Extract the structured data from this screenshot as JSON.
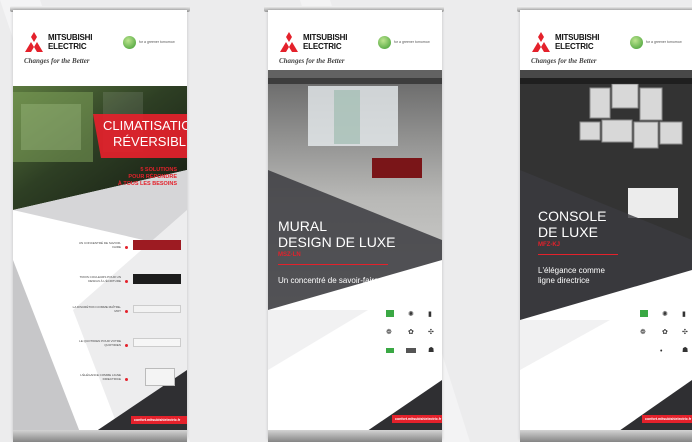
{
  "brand": {
    "name_line1": "MITSUBISHI",
    "name_line2": "ELECTRIC",
    "slogan": "Changes for the Better",
    "eco_text": "for a greener tomorrow"
  },
  "colors": {
    "brand_red": "#e4212b",
    "dark_grey": "#3b3b3f",
    "panel_bg": "#ffffff"
  },
  "banner1": {
    "title_line1": "CLIMATISATION",
    "title_line2": "RÉVERSIBLE",
    "subtitle_line1": "5 SOLUTIONS",
    "subtitle_line2": "POUR RÉPONDRE",
    "subtitle_line3": "À TOUS LES BESOINS",
    "features": [
      {
        "text": "UN CONCENTRÉ DE SAVOIR-FAIRE"
      },
      {
        "text": "TROIS COULEURS POUR UN DESIGN À L'ÉCRITURE"
      },
      {
        "text": "LA DISCRÉTION COMME MAÎTRE-MOT"
      },
      {
        "text": "LE QUOTIDIEN POUR VOTRE QUOTIDIEN"
      },
      {
        "text": "L'ÉLÉGANCE COMME LIGNE DIRECTRICE"
      }
    ],
    "url": "confort.mitsubishielectric.fr"
  },
  "banner2": {
    "title_line1": "MURAL",
    "title_line2": "DESIGN DE LUXE",
    "model": "MSZ-LN",
    "tagline": "Un concentré de savoir-faire",
    "url": "confort.mitsubishielectric.fr"
  },
  "banner3": {
    "title_line1": "CONSOLE",
    "title_line2": "DE LUXE",
    "model": "MFZ-KJ",
    "tagline_line1": "L'élégance comme",
    "tagline_line2": "ligne directrice",
    "url": "confort.mitsubishielectric.fr"
  }
}
